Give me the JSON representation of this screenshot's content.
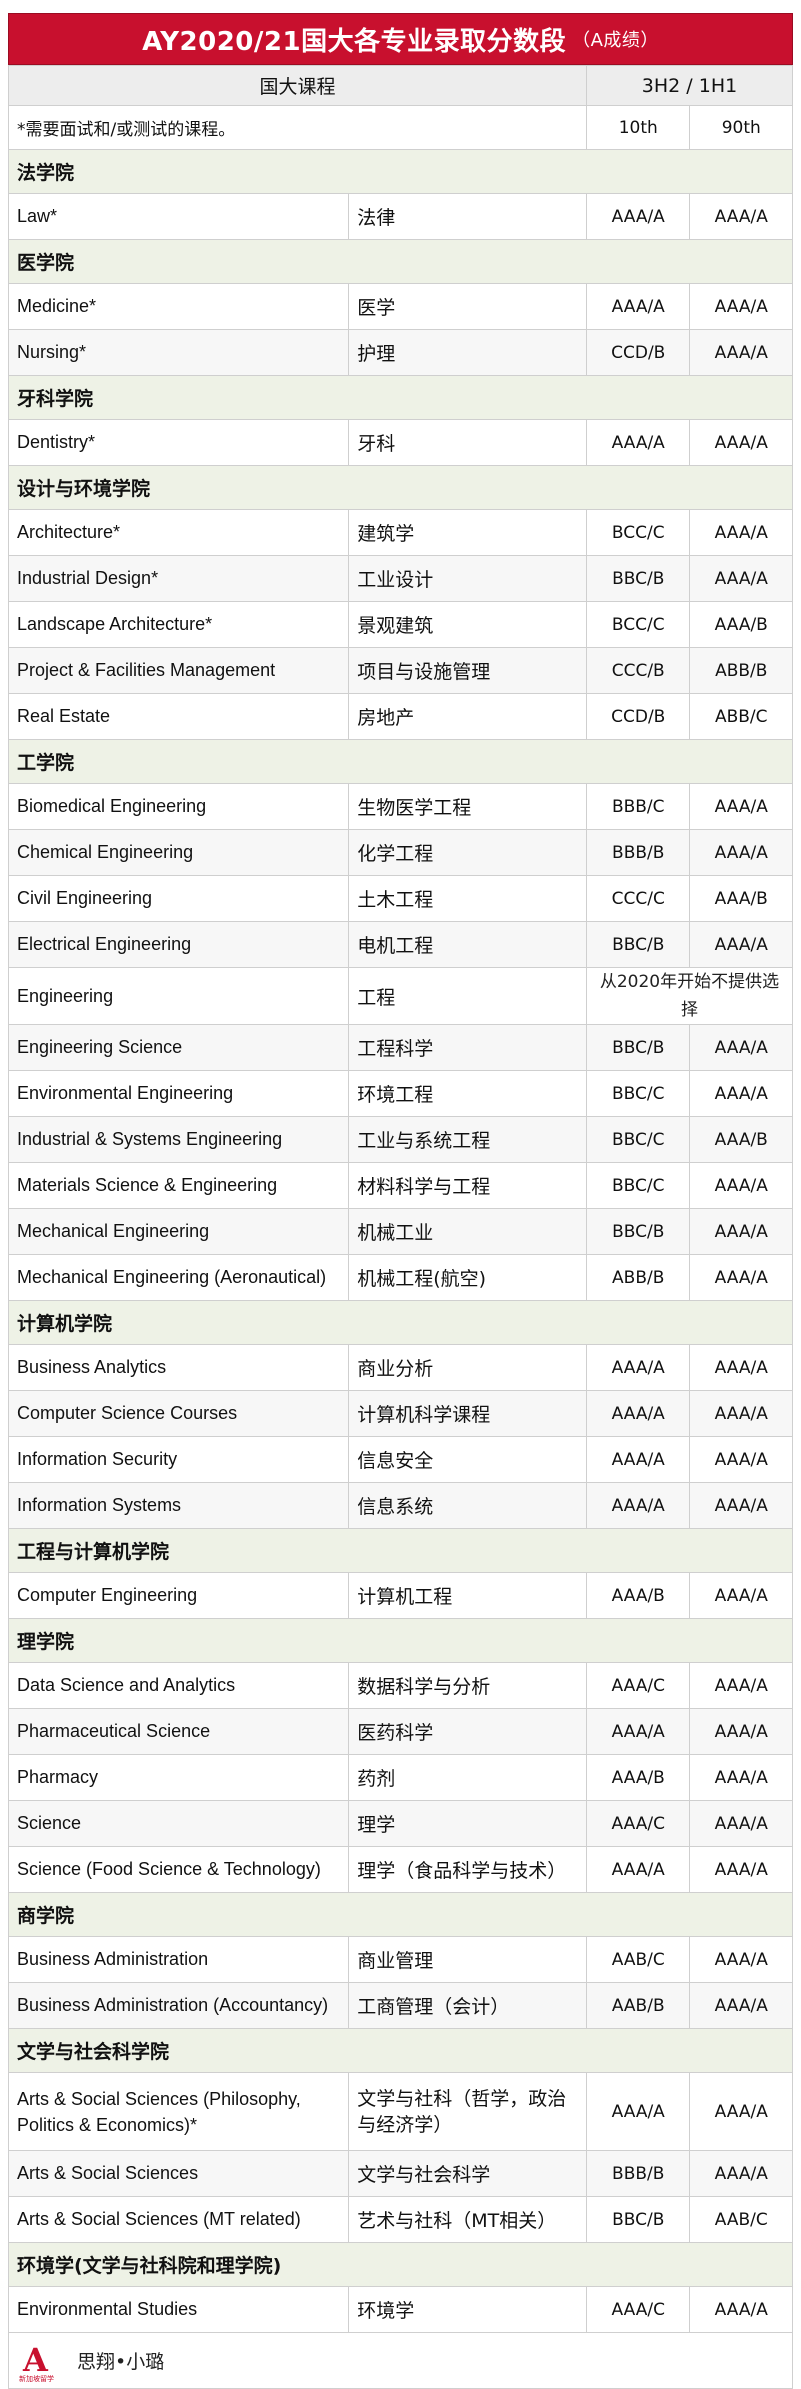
{
  "title": {
    "main": "AY2020/21国大各专业录取分数段",
    "sub": "（A成绩）"
  },
  "header": {
    "course": "国大课程",
    "grades": "3H2 / 1H1"
  },
  "subheader": {
    "note": "*需要面试和/或测试的课程。",
    "p10": "10th",
    "p90": "90th"
  },
  "sections": [
    {
      "name": "法学院",
      "rows": [
        {
          "en": "Law*",
          "cn": "法律",
          "p10": "AAA/A",
          "p90": "AAA/A"
        }
      ]
    },
    {
      "name": "医学院",
      "rows": [
        {
          "en": "Medicine*",
          "cn": "医学",
          "p10": "AAA/A",
          "p90": "AAA/A"
        },
        {
          "en": "Nursing*",
          "cn": "护理",
          "p10": "CCD/B",
          "p90": "AAA/A"
        }
      ]
    },
    {
      "name": "牙科学院",
      "rows": [
        {
          "en": "Dentistry*",
          "cn": "牙科",
          "p10": "AAA/A",
          "p90": "AAA/A"
        }
      ]
    },
    {
      "name": "设计与环境学院",
      "rows": [
        {
          "en": "Architecture*",
          "cn": "建筑学",
          "p10": "BCC/C",
          "p90": "AAA/A"
        },
        {
          "en": "Industrial Design*",
          "cn": "工业设计",
          "p10": "BBC/B",
          "p90": "AAA/A"
        },
        {
          "en": "Landscape Architecture*",
          "cn": "景观建筑",
          "p10": "BCC/C",
          "p90": "AAA/B"
        },
        {
          "en": "Project & Facilities Management",
          "cn": "项目与设施管理",
          "p10": "CCC/B",
          "p90": "ABB/B"
        },
        {
          "en": "Real Estate",
          "cn": "房地产",
          "p10": "CCD/B",
          "p90": "ABB/C"
        }
      ]
    },
    {
      "name": "工学院",
      "rows": [
        {
          "en": "Biomedical Engineering",
          "cn": "生物医学工程",
          "p10": "BBB/C",
          "p90": "AAA/A"
        },
        {
          "en": "Chemical Engineering",
          "cn": "化学工程",
          "p10": "BBB/B",
          "p90": "AAA/A"
        },
        {
          "en": "Civil Engineering",
          "cn": "土木工程",
          "p10": "CCC/C",
          "p90": "AAA/B"
        },
        {
          "en": "Electrical Engineering",
          "cn": "电机工程",
          "p10": "BBC/B",
          "p90": "AAA/A"
        },
        {
          "en": "Engineering",
          "cn": "工程",
          "note": "从2020年开始不提供选择"
        },
        {
          "en": "Engineering Science",
          "cn": "工程科学",
          "p10": "BBC/B",
          "p90": "AAA/A"
        },
        {
          "en": "Environmental Engineering",
          "cn": "环境工程",
          "p10": "BBC/C",
          "p90": "AAA/A"
        },
        {
          "en": "Industrial & Systems Engineering",
          "cn": "工业与系统工程",
          "p10": "BBC/C",
          "p90": "AAA/B"
        },
        {
          "en": "Materials Science & Engineering",
          "cn": "材料科学与工程",
          "p10": "BBC/C",
          "p90": "AAA/A"
        },
        {
          "en": "Mechanical Engineering",
          "cn": "机械工业",
          "p10": "BBC/B",
          "p90": "AAA/A"
        },
        {
          "en": "Mechanical Engineering (Aeronautical)",
          "cn": "机械工程(航空)",
          "p10": "ABB/B",
          "p90": "AAA/A"
        }
      ]
    },
    {
      "name": "计算机学院",
      "rows": [
        {
          "en": "Business Analytics",
          "cn": "商业分析",
          "p10": "AAA/A",
          "p90": "AAA/A"
        },
        {
          "en": "Computer Science Courses",
          "cn": "计算机科学课程",
          "p10": "AAA/A",
          "p90": "AAA/A"
        },
        {
          "en": "Information Security",
          "cn": "信息安全",
          "p10": "AAA/A",
          "p90": "AAA/A"
        },
        {
          "en": "Information Systems",
          "cn": "信息系统",
          "p10": "AAA/A",
          "p90": "AAA/A"
        }
      ]
    },
    {
      "name": "工程与计算机学院",
      "rows": [
        {
          "en": "Computer Engineering",
          "cn": "计算机工程",
          "p10": "AAA/B",
          "p90": "AAA/A"
        }
      ]
    },
    {
      "name": "理学院",
      "rows": [
        {
          "en": "Data Science and Analytics",
          "cn": "数据科学与分析",
          "p10": "AAA/C",
          "p90": "AAA/A"
        },
        {
          "en": "Pharmaceutical Science",
          "cn": "医药科学",
          "p10": "AAA/A",
          "p90": "AAA/A"
        },
        {
          "en": "Pharmacy",
          "cn": "药剂",
          "p10": "AAA/B",
          "p90": "AAA/A"
        },
        {
          "en": "Science",
          "cn": "理学",
          "p10": "AAA/C",
          "p90": "AAA/A"
        },
        {
          "en": "Science (Food Science & Technology)",
          "cn": "理学（食品科学与技术）",
          "p10": "AAA/A",
          "p90": "AAA/A"
        }
      ]
    },
    {
      "name": "商学院",
      "rows": [
        {
          "en": "Business Administration",
          "cn": "商业管理",
          "p10": "AAB/C",
          "p90": "AAA/A"
        },
        {
          "en": "Business Administration (Accountancy)",
          "cn": "工商管理（会计）",
          "p10": "AAB/B",
          "p90": "AAA/A"
        }
      ]
    },
    {
      "name": "文学与社会科学院",
      "rows": [
        {
          "en": "Arts & Social Sciences (Philosophy, Politics & Economics)*",
          "cn": "文学与社科（哲学，政治与经济学）",
          "p10": "AAA/A",
          "p90": "AAA/A",
          "tall": true
        },
        {
          "en": "Arts & Social Sciences",
          "cn": "文学与社会科学",
          "p10": "BBB/B",
          "p90": "AAA/A"
        },
        {
          "en": "Arts & Social Sciences (MT related)",
          "cn": "艺术与社科（MT相关）",
          "p10": "BBC/B",
          "p90": "AAB/C"
        }
      ]
    },
    {
      "name": "环境学(文学与社科院和理学院)",
      "rows": [
        {
          "en": "Environmental Studies",
          "cn": "环境学",
          "p10": "AAA/C",
          "p90": "AAA/A"
        }
      ]
    }
  ],
  "footer": {
    "logo_letter": "A",
    "logo_caption": "新加坡留学",
    "brand": "思翔•小璐"
  },
  "colors": {
    "title_bg": "#c8102e",
    "section_bg": "#eef2e6",
    "header_bg": "#ededed"
  }
}
